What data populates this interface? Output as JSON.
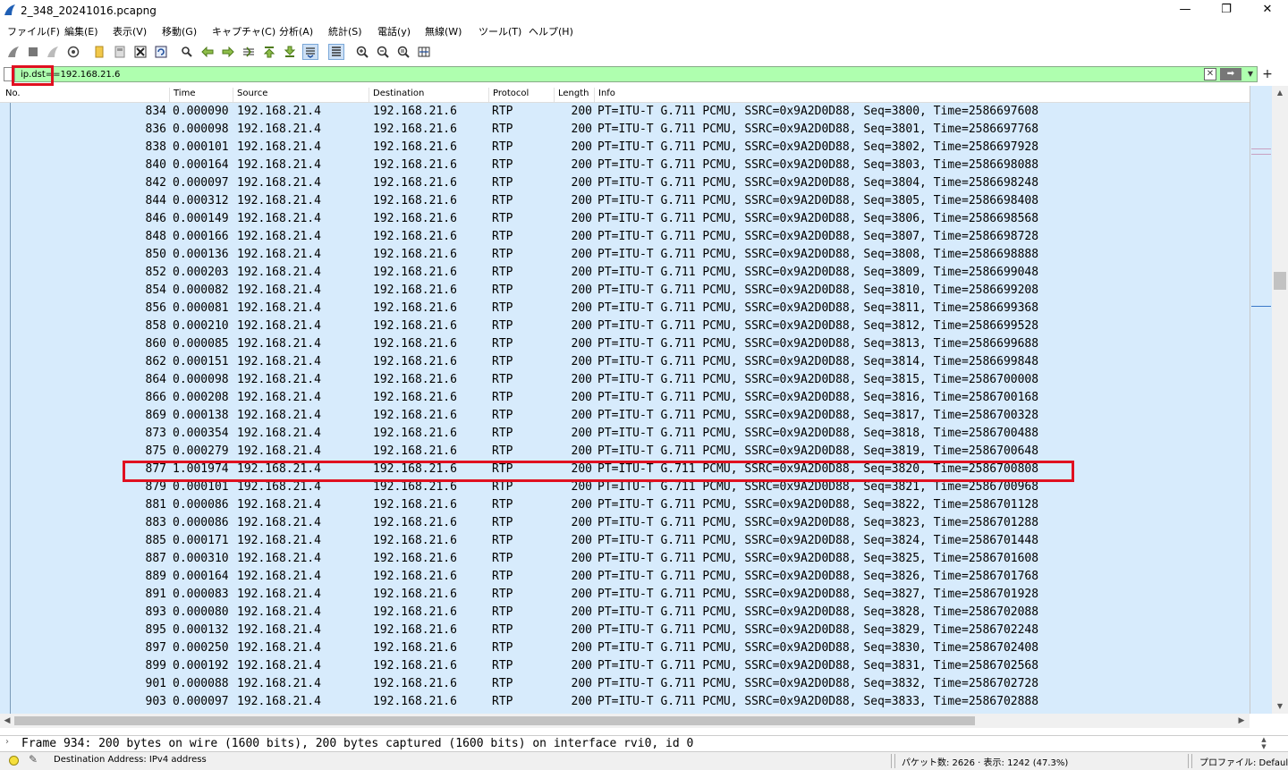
{
  "window": {
    "title": "2_348_20241016.pcapng",
    "minimize": "—",
    "restore": "❐",
    "close": "✕"
  },
  "menu": [
    "ファイル(F)",
    "編集(E)",
    "表示(V)",
    "移動(G)",
    "キャプチャ(C)",
    "分析(A)",
    "統計(S)",
    "電話(y)",
    "無線(W)",
    "ツール(T)",
    "ヘルプ(H)"
  ],
  "filter": {
    "value": "ip.dst==192.168.21.6"
  },
  "columns": {
    "no": "No.",
    "time": "Time",
    "source": "Source",
    "destination": "Destination",
    "protocol": "Protocol",
    "length": "Length",
    "info": "Info"
  },
  "rows": [
    {
      "no": "834",
      "time": "0.000090",
      "src": "192.168.21.4",
      "dst": "192.168.21.6",
      "proto": "RTP",
      "len": "200",
      "info": "PT=ITU-T G.711 PCMU, SSRC=0x9A2D0D88, Seq=3800, Time=2586697608"
    },
    {
      "no": "836",
      "time": "0.000098",
      "src": "192.168.21.4",
      "dst": "192.168.21.6",
      "proto": "RTP",
      "len": "200",
      "info": "PT=ITU-T G.711 PCMU, SSRC=0x9A2D0D88, Seq=3801, Time=2586697768"
    },
    {
      "no": "838",
      "time": "0.000101",
      "src": "192.168.21.4",
      "dst": "192.168.21.6",
      "proto": "RTP",
      "len": "200",
      "info": "PT=ITU-T G.711 PCMU, SSRC=0x9A2D0D88, Seq=3802, Time=2586697928"
    },
    {
      "no": "840",
      "time": "0.000164",
      "src": "192.168.21.4",
      "dst": "192.168.21.6",
      "proto": "RTP",
      "len": "200",
      "info": "PT=ITU-T G.711 PCMU, SSRC=0x9A2D0D88, Seq=3803, Time=2586698088"
    },
    {
      "no": "842",
      "time": "0.000097",
      "src": "192.168.21.4",
      "dst": "192.168.21.6",
      "proto": "RTP",
      "len": "200",
      "info": "PT=ITU-T G.711 PCMU, SSRC=0x9A2D0D88, Seq=3804, Time=2586698248"
    },
    {
      "no": "844",
      "time": "0.000312",
      "src": "192.168.21.4",
      "dst": "192.168.21.6",
      "proto": "RTP",
      "len": "200",
      "info": "PT=ITU-T G.711 PCMU, SSRC=0x9A2D0D88, Seq=3805, Time=2586698408"
    },
    {
      "no": "846",
      "time": "0.000149",
      "src": "192.168.21.4",
      "dst": "192.168.21.6",
      "proto": "RTP",
      "len": "200",
      "info": "PT=ITU-T G.711 PCMU, SSRC=0x9A2D0D88, Seq=3806, Time=2586698568"
    },
    {
      "no": "848",
      "time": "0.000166",
      "src": "192.168.21.4",
      "dst": "192.168.21.6",
      "proto": "RTP",
      "len": "200",
      "info": "PT=ITU-T G.711 PCMU, SSRC=0x9A2D0D88, Seq=3807, Time=2586698728"
    },
    {
      "no": "850",
      "time": "0.000136",
      "src": "192.168.21.4",
      "dst": "192.168.21.6",
      "proto": "RTP",
      "len": "200",
      "info": "PT=ITU-T G.711 PCMU, SSRC=0x9A2D0D88, Seq=3808, Time=2586698888"
    },
    {
      "no": "852",
      "time": "0.000203",
      "src": "192.168.21.4",
      "dst": "192.168.21.6",
      "proto": "RTP",
      "len": "200",
      "info": "PT=ITU-T G.711 PCMU, SSRC=0x9A2D0D88, Seq=3809, Time=2586699048"
    },
    {
      "no": "854",
      "time": "0.000082",
      "src": "192.168.21.4",
      "dst": "192.168.21.6",
      "proto": "RTP",
      "len": "200",
      "info": "PT=ITU-T G.711 PCMU, SSRC=0x9A2D0D88, Seq=3810, Time=2586699208"
    },
    {
      "no": "856",
      "time": "0.000081",
      "src": "192.168.21.4",
      "dst": "192.168.21.6",
      "proto": "RTP",
      "len": "200",
      "info": "PT=ITU-T G.711 PCMU, SSRC=0x9A2D0D88, Seq=3811, Time=2586699368"
    },
    {
      "no": "858",
      "time": "0.000210",
      "src": "192.168.21.4",
      "dst": "192.168.21.6",
      "proto": "RTP",
      "len": "200",
      "info": "PT=ITU-T G.711 PCMU, SSRC=0x9A2D0D88, Seq=3812, Time=2586699528"
    },
    {
      "no": "860",
      "time": "0.000085",
      "src": "192.168.21.4",
      "dst": "192.168.21.6",
      "proto": "RTP",
      "len": "200",
      "info": "PT=ITU-T G.711 PCMU, SSRC=0x9A2D0D88, Seq=3813, Time=2586699688"
    },
    {
      "no": "862",
      "time": "0.000151",
      "src": "192.168.21.4",
      "dst": "192.168.21.6",
      "proto": "RTP",
      "len": "200",
      "info": "PT=ITU-T G.711 PCMU, SSRC=0x9A2D0D88, Seq=3814, Time=2586699848"
    },
    {
      "no": "864",
      "time": "0.000098",
      "src": "192.168.21.4",
      "dst": "192.168.21.6",
      "proto": "RTP",
      "len": "200",
      "info": "PT=ITU-T G.711 PCMU, SSRC=0x9A2D0D88, Seq=3815, Time=2586700008"
    },
    {
      "no": "866",
      "time": "0.000208",
      "src": "192.168.21.4",
      "dst": "192.168.21.6",
      "proto": "RTP",
      "len": "200",
      "info": "PT=ITU-T G.711 PCMU, SSRC=0x9A2D0D88, Seq=3816, Time=2586700168"
    },
    {
      "no": "869",
      "time": "0.000138",
      "src": "192.168.21.4",
      "dst": "192.168.21.6",
      "proto": "RTP",
      "len": "200",
      "info": "PT=ITU-T G.711 PCMU, SSRC=0x9A2D0D88, Seq=3817, Time=2586700328"
    },
    {
      "no": "873",
      "time": "0.000354",
      "src": "192.168.21.4",
      "dst": "192.168.21.6",
      "proto": "RTP",
      "len": "200",
      "info": "PT=ITU-T G.711 PCMU, SSRC=0x9A2D0D88, Seq=3818, Time=2586700488"
    },
    {
      "no": "875",
      "time": "0.000279",
      "src": "192.168.21.4",
      "dst": "192.168.21.6",
      "proto": "RTP",
      "len": "200",
      "info": "PT=ITU-T G.711 PCMU, SSRC=0x9A2D0D88, Seq=3819, Time=2586700648"
    },
    {
      "no": "877",
      "time": "1.001974",
      "src": "192.168.21.4",
      "dst": "192.168.21.6",
      "proto": "RTP",
      "len": "200",
      "info": "PT=ITU-T G.711 PCMU, SSRC=0x9A2D0D88, Seq=3820, Time=2586700808"
    },
    {
      "no": "879",
      "time": "0.000101",
      "src": "192.168.21.4",
      "dst": "192.168.21.6",
      "proto": "RTP",
      "len": "200",
      "info": "PT=ITU-T G.711 PCMU, SSRC=0x9A2D0D88, Seq=3821, Time=2586700968"
    },
    {
      "no": "881",
      "time": "0.000086",
      "src": "192.168.21.4",
      "dst": "192.168.21.6",
      "proto": "RTP",
      "len": "200",
      "info": "PT=ITU-T G.711 PCMU, SSRC=0x9A2D0D88, Seq=3822, Time=2586701128"
    },
    {
      "no": "883",
      "time": "0.000086",
      "src": "192.168.21.4",
      "dst": "192.168.21.6",
      "proto": "RTP",
      "len": "200",
      "info": "PT=ITU-T G.711 PCMU, SSRC=0x9A2D0D88, Seq=3823, Time=2586701288"
    },
    {
      "no": "885",
      "time": "0.000171",
      "src": "192.168.21.4",
      "dst": "192.168.21.6",
      "proto": "RTP",
      "len": "200",
      "info": "PT=ITU-T G.711 PCMU, SSRC=0x9A2D0D88, Seq=3824, Time=2586701448"
    },
    {
      "no": "887",
      "time": "0.000310",
      "src": "192.168.21.4",
      "dst": "192.168.21.6",
      "proto": "RTP",
      "len": "200",
      "info": "PT=ITU-T G.711 PCMU, SSRC=0x9A2D0D88, Seq=3825, Time=2586701608"
    },
    {
      "no": "889",
      "time": "0.000164",
      "src": "192.168.21.4",
      "dst": "192.168.21.6",
      "proto": "RTP",
      "len": "200",
      "info": "PT=ITU-T G.711 PCMU, SSRC=0x9A2D0D88, Seq=3826, Time=2586701768"
    },
    {
      "no": "891",
      "time": "0.000083",
      "src": "192.168.21.4",
      "dst": "192.168.21.6",
      "proto": "RTP",
      "len": "200",
      "info": "PT=ITU-T G.711 PCMU, SSRC=0x9A2D0D88, Seq=3827, Time=2586701928"
    },
    {
      "no": "893",
      "time": "0.000080",
      "src": "192.168.21.4",
      "dst": "192.168.21.6",
      "proto": "RTP",
      "len": "200",
      "info": "PT=ITU-T G.711 PCMU, SSRC=0x9A2D0D88, Seq=3828, Time=2586702088"
    },
    {
      "no": "895",
      "time": "0.000132",
      "src": "192.168.21.4",
      "dst": "192.168.21.6",
      "proto": "RTP",
      "len": "200",
      "info": "PT=ITU-T G.711 PCMU, SSRC=0x9A2D0D88, Seq=3829, Time=2586702248"
    },
    {
      "no": "897",
      "time": "0.000250",
      "src": "192.168.21.4",
      "dst": "192.168.21.6",
      "proto": "RTP",
      "len": "200",
      "info": "PT=ITU-T G.711 PCMU, SSRC=0x9A2D0D88, Seq=3830, Time=2586702408"
    },
    {
      "no": "899",
      "time": "0.000192",
      "src": "192.168.21.4",
      "dst": "192.168.21.6",
      "proto": "RTP",
      "len": "200",
      "info": "PT=ITU-T G.711 PCMU, SSRC=0x9A2D0D88, Seq=3831, Time=2586702568"
    },
    {
      "no": "901",
      "time": "0.000088",
      "src": "192.168.21.4",
      "dst": "192.168.21.6",
      "proto": "RTP",
      "len": "200",
      "info": "PT=ITU-T G.711 PCMU, SSRC=0x9A2D0D88, Seq=3832, Time=2586702728"
    },
    {
      "no": "903",
      "time": "0.000097",
      "src": "192.168.21.4",
      "dst": "192.168.21.6",
      "proto": "RTP",
      "len": "200",
      "info": "PT=ITU-T G.711 PCMU, SSRC=0x9A2D0D88, Seq=3833, Time=2586702888"
    }
  ],
  "details": {
    "frame_summary": "Frame 934: 200 bytes on wire (1600 bits), 200 bytes captured (1600 bits) on interface rvi0, id 0"
  },
  "status": {
    "field_info": "Destination Address: IPv4 address",
    "packets": "パケット数: 2626 · 表示: 1242 (47.3%)",
    "profile": "プロファイル: Default"
  },
  "colors": {
    "row_background": "#d7ebfc",
    "filter_valid": "#afffaf",
    "annotation_red": "#e01020"
  }
}
